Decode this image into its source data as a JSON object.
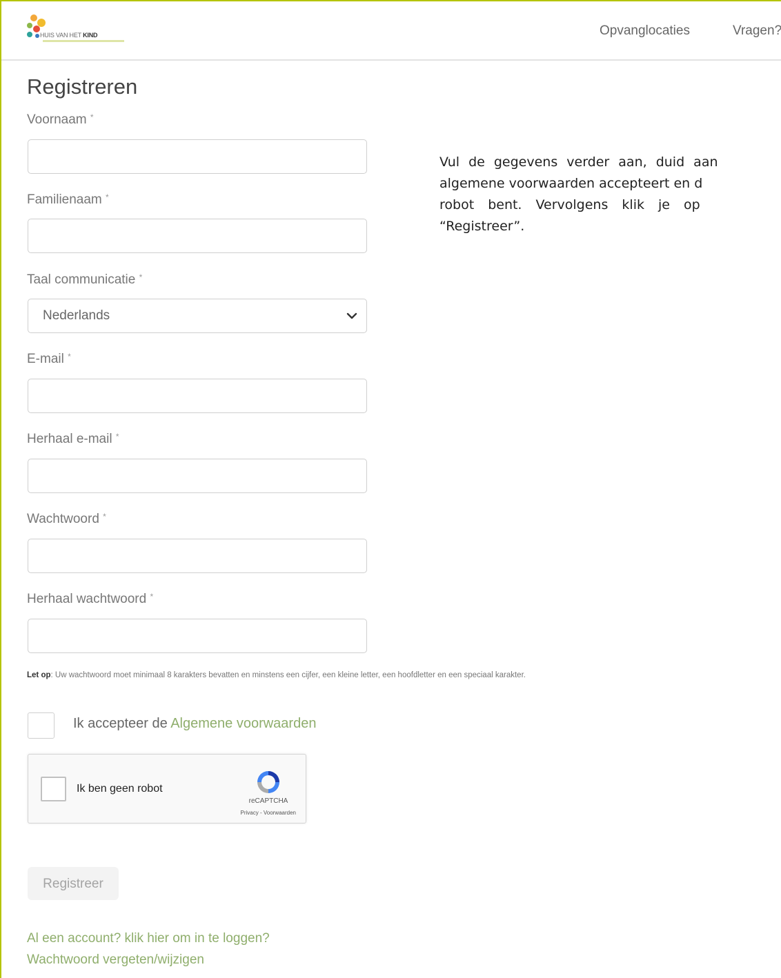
{
  "header": {
    "logo_text": "HUIS VAN HET",
    "logo_text_bold": "KIND",
    "nav": [
      {
        "label": "Opvanglocaties"
      },
      {
        "label": "Vragen?"
      }
    ]
  },
  "page_title": "Registreren",
  "form": {
    "required_marker": "*",
    "first_name": {
      "label": "Voornaam",
      "value": ""
    },
    "last_name": {
      "label": "Familienaam",
      "value": ""
    },
    "language": {
      "label": "Taal communicatie",
      "selected": "Nederlands"
    },
    "email": {
      "label": "E-mail",
      "value": ""
    },
    "email_repeat": {
      "label": "Herhaal e-mail",
      "value": ""
    },
    "password": {
      "label": "Wachtwoord",
      "value": ""
    },
    "password_repeat": {
      "label": "Herhaal wachtwoord",
      "value": ""
    },
    "note_bold": "Let op",
    "note_text": ": Uw wachtwoord moet minimaal 8 karakters bevatten en minstens een cijfer, een kleine letter, een hoofdletter en een speciaal karakter.",
    "accept_prefix": "Ik accepteer de ",
    "accept_link": "Algemene voorwaarden",
    "submit_label": "Registreer"
  },
  "captcha": {
    "label": "Ik ben geen robot",
    "brand": "reCAPTCHA",
    "terms": "Privacy - Voorwaarden"
  },
  "instructions": {
    "line1": "Vul de gegevens verder aan, duid aan",
    "line2": "algemene voorwaarden accepteert en d",
    "line3": "robot bent. Vervolgens klik je op",
    "line4": "“Registreer”."
  },
  "links": {
    "login": "Al een account? klik hier om in te loggen?",
    "forgot_password": "Wachtwoord vergeten/wijzigen"
  },
  "colors": {
    "accent_frame": "#b5c400",
    "link_green": "#8fae6c"
  }
}
